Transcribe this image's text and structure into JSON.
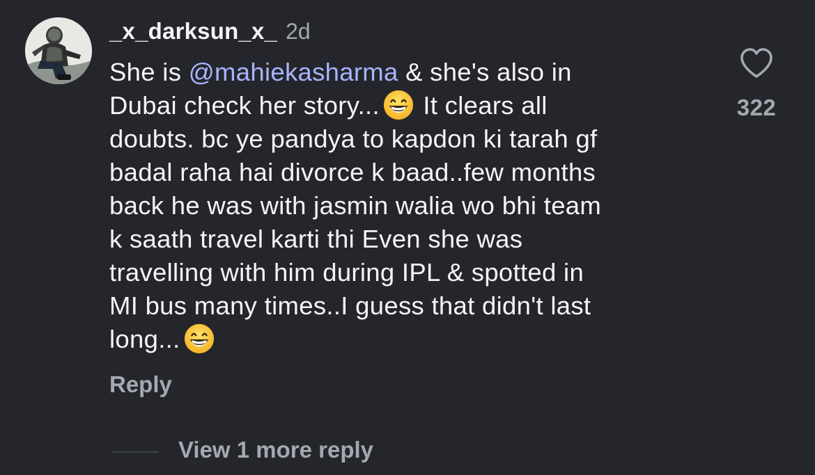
{
  "comment": {
    "username": "_x_darksun_x_",
    "timestamp": "2d",
    "lines": [
      {
        "before": "She is ",
        "mention": "@mahiekasharma",
        "after": " & she's also in"
      },
      {
        "before": "Dubai check her story...",
        "after": " It clears all"
      },
      {
        "text": "doubts. bc ye pandya to kapdon ki tarah gf"
      },
      {
        "text": "badal raha hai divorce k baad..few months"
      },
      {
        "text": "back he was with jasmin walia wo bhi team"
      },
      {
        "text": "k saath travel karti thi Even she was"
      },
      {
        "text": "travelling with him during IPL & spotted in"
      },
      {
        "text": "MI bus many times..I guess that didn't last"
      },
      {
        "text": "long..."
      }
    ],
    "emoji": "grinning-face-with-smiling-eyes",
    "reply_label": "Reply",
    "like_count": "322",
    "view_replies_label": "View 1 more reply"
  },
  "colors": {
    "background": "#24262b",
    "text": "#f4f5f7",
    "secondary": "#a4a8b0",
    "mention": "#a8b4ff"
  },
  "icons": {
    "avatar": "user-avatar",
    "like": "heart-outline-icon"
  }
}
